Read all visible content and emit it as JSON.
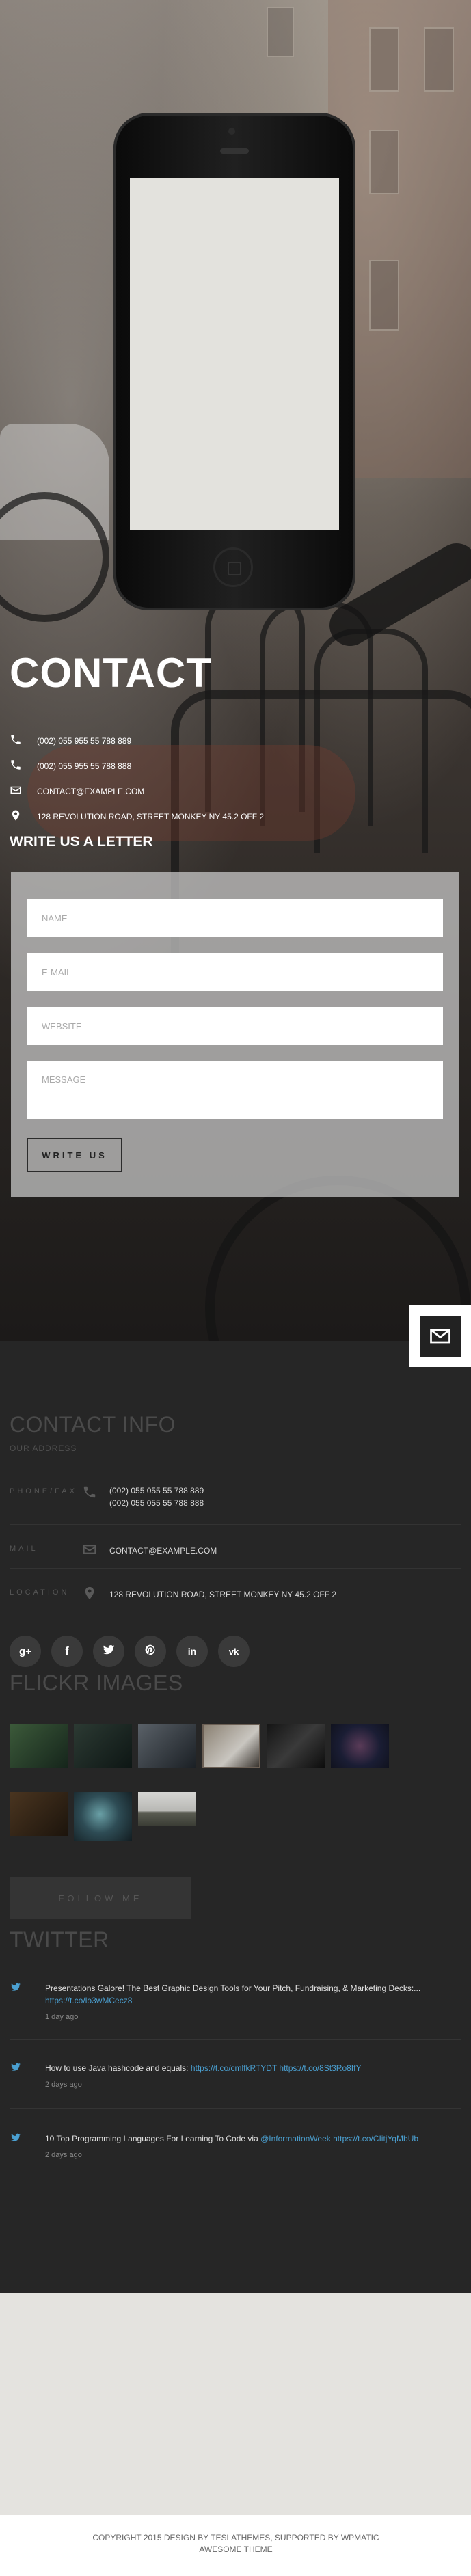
{
  "hero": {
    "title": "CONTACT",
    "phone1": "(002) 055 955 55 788 889",
    "phone2": "(002) 055 955 55 788 888",
    "email": "CONTACT@EXAMPLE.COM",
    "address": "128 REVOLUTION ROAD, STREET MONKEY NY 45.2 OFF 2"
  },
  "form": {
    "title": "WRITE US A LETTER",
    "name_placeholder": "NAME",
    "email_placeholder": "E-MAIL",
    "website_placeholder": "WEBSITE",
    "message_placeholder": "MESSAGE",
    "submit_label": "WRITE US"
  },
  "contact_info": {
    "title": "CONTACT INFO",
    "subtitle": "OUR ADDRESS",
    "phone_label": "PHONE/FAX",
    "phone1": "(002) 055 055 55 788 889",
    "phone2": "(002) 055 055 55 788 888",
    "mail_label": "MAIL",
    "email": "CONTACT@EXAMPLE.COM",
    "location_label": "LOCATION",
    "address": "128 REVOLUTION ROAD, STREET MONKEY NY 45.2 OFF 2"
  },
  "social": [
    "google-plus-icon",
    "facebook-icon",
    "twitter-icon",
    "pinterest-icon",
    "linkedin-icon",
    "vk-icon"
  ],
  "flickr": {
    "title": "FLICKR IMAGES",
    "follow_label": "FOLLOW ME"
  },
  "twitter": {
    "title": "TWITTER",
    "tweets": [
      {
        "text": "Presentations Galore! The Best Graphic Design Tools for Your Pitch, Fundraising, & Marketing Decks:...",
        "link": "https://t.co/lo3wMCecz8",
        "date": "1 day ago"
      },
      {
        "text": "How to use Java hashcode and equals:",
        "link": "https://t.co/cmlfkRTYDT https://t.co/8St3Ro8IfY",
        "date": "2 days ago"
      },
      {
        "text": "10 Top Programming Languages For Learning To Code via",
        "link": "@InformationWeek https://t.co/CIitjYqMbUb",
        "date": "2 days ago"
      }
    ]
  },
  "footer": {
    "line1": "COPYRIGHT 2015 DESIGN BY TESLATHEMES, SUPPORTED BY WPMATIC",
    "line2": "AWESOME THEME"
  }
}
